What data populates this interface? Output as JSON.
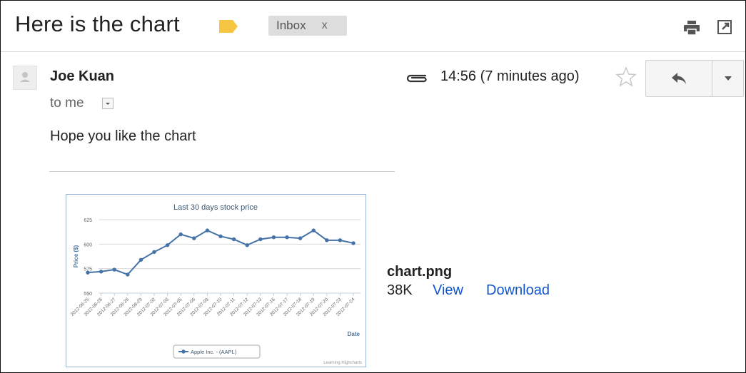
{
  "header": {
    "subject": "Here is the chart",
    "label_color": "#f6c642",
    "inbox_chip": {
      "label": "Inbox",
      "remove": "x"
    }
  },
  "message": {
    "sender": "Joe Kuan",
    "recipient": "to me",
    "time": "14:56 (7 minutes ago)",
    "body": "Hope you like the chart"
  },
  "attachment": {
    "filename": "chart.png",
    "size": "38K",
    "view_label": "View",
    "download_label": "Download"
  },
  "chart_data": {
    "type": "line",
    "title": "Last 30 days stock price",
    "ylabel": "Price ($)",
    "xlabel": "Date",
    "ylim": [
      550,
      625
    ],
    "yticks": [
      550,
      575,
      600,
      625
    ],
    "x": [
      "2012-06-25",
      "2012-06-26",
      "2012-06-27",
      "2012-06-28",
      "2012-06-29",
      "2012-07-02",
      "2012-07-03",
      "2012-07-05",
      "2012-07-06",
      "2012-07-09",
      "2012-07-10",
      "2012-07-11",
      "2012-07-12",
      "2012-07-13",
      "2012-07-16",
      "2012-07-17",
      "2012-07-18",
      "2012-07-19",
      "2012-07-20",
      "2012-07-23",
      "2012-07-24"
    ],
    "series": [
      {
        "name": "Apple Inc. - (AAPL)",
        "color": "#4572a7",
        "values": [
          571,
          572,
          574,
          569,
          584,
          592,
          599,
          610,
          606,
          614,
          608,
          605,
          599,
          605,
          607,
          607,
          606,
          614,
          604,
          604,
          601
        ]
      }
    ],
    "credits": "Learning Highcharts",
    "grid": true,
    "legend_position": "bottom"
  }
}
